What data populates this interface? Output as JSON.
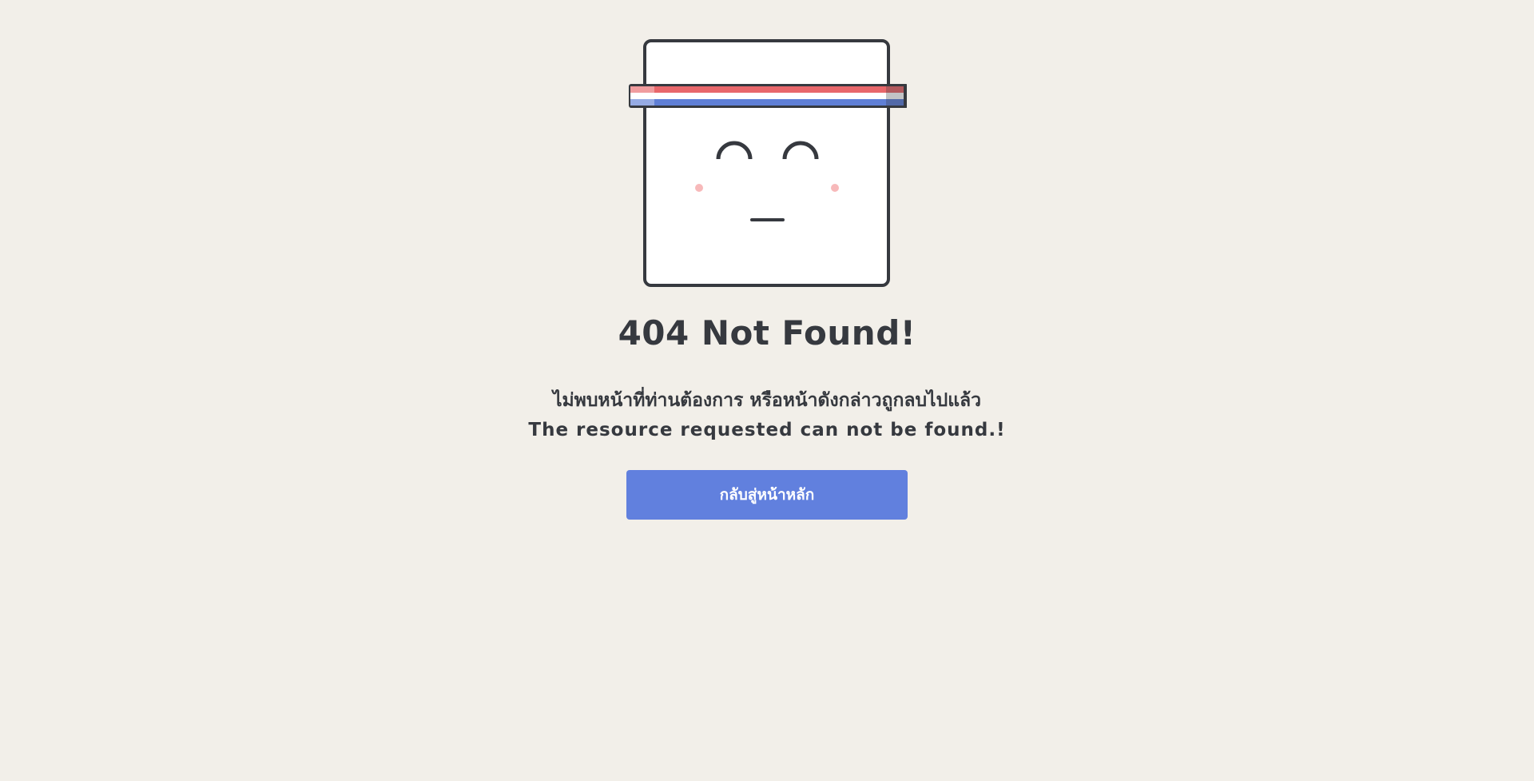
{
  "error": {
    "title": "404 Not Found!",
    "message_th": "ไม่พบหน้าที่ท่านต้องการ หรือหน้าดังกล่าวถูกลบไปแล้ว",
    "message_en": "The resource requested can not be found.!"
  },
  "actions": {
    "home_button_label": "กลับสู่หน้าหลัก"
  },
  "colors": {
    "background": "#f2efe9",
    "text": "#36393f",
    "button": "#6180de",
    "headband_red": "#e8676b",
    "headband_blue": "#5f7fd6",
    "cheek": "#f7b9ba"
  },
  "icons": {
    "mascot": "square-face-with-headband-icon"
  }
}
